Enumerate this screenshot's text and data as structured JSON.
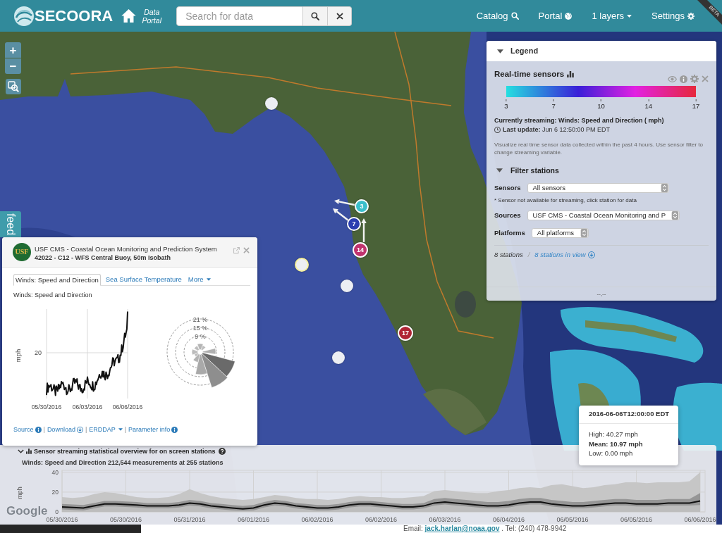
{
  "header": {
    "logo": "SECOORA",
    "home_label": "Data Portal",
    "search": {
      "placeholder": "Search for data"
    },
    "nav": [
      {
        "label": "Catalog",
        "kind": "search"
      },
      {
        "label": "Portal",
        "kind": "globe"
      },
      {
        "label": "1 layers",
        "kind": "dropdown"
      },
      {
        "label": "Settings",
        "kind": "settings"
      }
    ],
    "ribbon": "BETA"
  },
  "map": {
    "zoom_in": "+",
    "zoom_out": "−",
    "feedback_tab": "feed",
    "markers": [
      {
        "kind": "plain",
        "selected": false
      },
      {
        "kind": "streaming",
        "label": "3",
        "color": "#3bbfcb",
        "selected": false
      },
      {
        "kind": "streaming",
        "label": "7",
        "color": "#2c3fb0",
        "selected": false
      },
      {
        "kind": "streaming",
        "label": "14",
        "color": "#c0336e",
        "selected": false
      },
      {
        "kind": "plain",
        "selected": true
      },
      {
        "kind": "plain",
        "selected": false
      },
      {
        "kind": "streaming",
        "label": "17",
        "color": "#b02535",
        "selected": false
      },
      {
        "kind": "plain",
        "selected": false
      }
    ],
    "logo": "Google"
  },
  "legend": {
    "title": "Legend",
    "expanded": true,
    "layer": {
      "title": "Real-time sensors",
      "scale_ticks": [
        "3",
        "7",
        "10",
        "14",
        "17"
      ],
      "streaming": "Currently streaming: Winds: Speed and Direction ( mph)",
      "last_update": "**Last update:** Jun 6 12:50:00 PM EDT",
      "description": "Visualize real time sensor data collected within the past 4 hours. Use sensor filter to change streaming variable."
    },
    "filter": {
      "title": "Filter stations",
      "expanded": true,
      "rows": [
        {
          "kind": "select",
          "label": "Sensors",
          "value": "All sensors"
        },
        {
          "kind": "note",
          "text": "* Sensor not available for streaming, click station for data"
        },
        {
          "kind": "select",
          "label": "Sources",
          "value": "USF CMS - Coastal Ocean Monitoring and P"
        },
        {
          "kind": "select",
          "label": "Platforms",
          "value": "All platforms"
        }
      ],
      "count": "8 stations",
      "separator": "/",
      "in_view": "8 stations in view"
    },
    "footer": "--,--"
  },
  "popup": {
    "logo": "USF",
    "title": "USF CMS - Coastal Ocean Monitoring and Prediction System",
    "subtitle": "42022 - C12 - WFS Central Buoy, 50m Isobath",
    "tabs": [
      {
        "label": "Winds: Speed and Direction",
        "selected": true,
        "kind": "tab"
      },
      {
        "label": "Sea Surface Temperature",
        "selected": false,
        "kind": "tab"
      },
      {
        "label": "More",
        "selected": false,
        "kind": "dropdown"
      }
    ],
    "chart_title": "Winds: Speed and Direction",
    "line_chart": {
      "ylabel": "mph",
      "ytick": "20",
      "xticks": [
        "05/30/2016",
        "06/03/2016",
        "06/06/2016"
      ]
    },
    "wind_rose": {
      "rings": [
        "21 %",
        "15 %",
        "9 %"
      ]
    },
    "links": [
      {
        "kind": "info",
        "label": "Source"
      },
      {
        "kind": "separator",
        "label": "|"
      },
      {
        "kind": "download",
        "label": "Download"
      },
      {
        "kind": "separator",
        "label": "|"
      },
      {
        "kind": "dropdown",
        "label": "ERDDAP"
      },
      {
        "kind": "separator",
        "label": "|"
      },
      {
        "kind": "info",
        "label": "Parameter info"
      }
    ]
  },
  "overview": {
    "title": "Sensor streaming statistical overview for on screen stations",
    "expanded": true,
    "subtitle": "Winds: Speed and Direction 212,544 measurements at 255 stations",
    "chart_data": {
      "type": "area",
      "ylabel": "mph",
      "categories": [
        "05/30/2016",
        null,
        null,
        null,
        null,
        null,
        "05/30/2016",
        null,
        null,
        null,
        null,
        null,
        "05/31/2016",
        null,
        null,
        null,
        null,
        null,
        "06/01/2016",
        null,
        null,
        null,
        null,
        null,
        "06/02/2016",
        null,
        null,
        null,
        null,
        null,
        "06/02/2016",
        null,
        null,
        null,
        null,
        null,
        "06/03/2016",
        null,
        null,
        null,
        null,
        null,
        "06/04/2016",
        null,
        null,
        null,
        null,
        null,
        "06/05/2016",
        null,
        null,
        null,
        null,
        null,
        "06/05/2016",
        null,
        null,
        null,
        null,
        null,
        "06/06/2016"
      ],
      "ylim": [
        0,
        42
      ],
      "yticks": [
        0,
        20,
        40
      ],
      "grid": true,
      "stacked": false,
      "series": [
        {
          "type": "area",
          "color": "#c6c6c6",
          "values": [
            15,
            14,
            15,
            18,
            20,
            19,
            17,
            15,
            14,
            14,
            15,
            18,
            23,
            19,
            16,
            14,
            13,
            12,
            13,
            15,
            17,
            16,
            14,
            13,
            13,
            12,
            13,
            15,
            16,
            15,
            15,
            14,
            14,
            15,
            16,
            21,
            22,
            21,
            20,
            19,
            19,
            21,
            22,
            24,
            25,
            24,
            27,
            28,
            26,
            24,
            25,
            27,
            28,
            30,
            30,
            29,
            30,
            30,
            30,
            31,
            40
          ]
        },
        {
          "type": "area",
          "color": "#969696",
          "values": [
            8,
            7.5,
            7,
            9,
            11,
            11,
            10.5,
            10,
            9,
            9,
            9,
            10,
            12,
            11,
            9,
            8,
            7,
            6,
            7,
            10,
            12,
            11,
            9,
            8,
            7,
            7,
            8,
            10,
            11,
            11,
            10,
            9,
            8,
            8,
            9,
            13,
            14,
            13,
            12,
            11,
            10,
            10,
            11,
            13,
            14,
            14,
            12,
            11,
            10,
            10,
            11,
            12,
            13,
            13,
            12,
            12,
            12,
            13,
            13,
            13,
            19
          ]
        },
        {
          "type": "area",
          "color": "#bdbdbd",
          "values": [
            2.5,
            2,
            1.5,
            3.5,
            5.5,
            5.5,
            5,
            4.5,
            3.5,
            3.5,
            3.5,
            4.5,
            6.5,
            5.5,
            3.5,
            2.5,
            1.5,
            1,
            1.5,
            4.5,
            6.5,
            5.5,
            3.5,
            2.5,
            1.5,
            1.5,
            2.5,
            4.5,
            5.5,
            5.5,
            4.5,
            3.5,
            2.5,
            2.5,
            3.5,
            6.5,
            7.5,
            6.5,
            5.5,
            4.5,
            3.5,
            3.5,
            4.5,
            6.5,
            7.5,
            7.5,
            5.5,
            4.5,
            3.5,
            3.5,
            4.5,
            5.5,
            6.5,
            6.5,
            5.5,
            5.5,
            5.5,
            6.5,
            6.5,
            6.5,
            7
          ]
        },
        {
          "type": "line",
          "color": "#111111",
          "values": [
            5,
            4.5,
            4,
            6,
            8,
            8,
            7.5,
            7,
            6,
            6,
            6,
            7,
            9,
            8,
            6,
            5,
            4,
            3,
            4,
            7,
            9,
            8,
            6,
            5,
            4,
            4,
            5,
            7,
            8,
            8,
            7,
            6,
            5,
            5,
            6,
            9,
            10,
            9,
            8,
            7,
            6,
            6,
            7,
            9,
            10,
            10,
            8,
            7,
            6,
            6,
            7,
            8,
            9,
            9,
            8,
            8,
            8,
            9,
            9,
            9,
            11
          ]
        }
      ]
    }
  },
  "tooltip": {
    "title": "2016-06-06T12:00:00 EDT",
    "high": "High: 40.27 mph",
    "mean": "Mean: 10.97 mph",
    "low": "Low: 0.00 mph"
  },
  "footer": {
    "prefix": "Email:",
    "email": "jack.harlan@noaa.gov",
    "suffix": ". Tel: (240) 478-9942"
  }
}
